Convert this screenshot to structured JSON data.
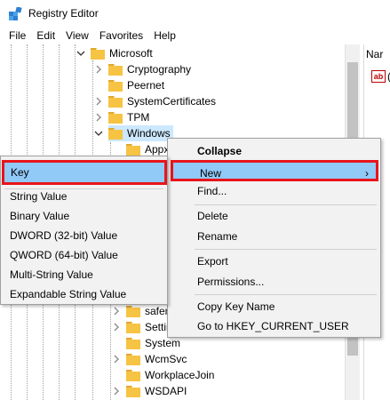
{
  "window": {
    "title": "Registry Editor",
    "icon": "registry-editor-icon"
  },
  "menubar": {
    "items": [
      {
        "label": "File"
      },
      {
        "label": "Edit"
      },
      {
        "label": "View"
      },
      {
        "label": "Favorites"
      },
      {
        "label": "Help"
      }
    ]
  },
  "tree": {
    "microsoft": "Microsoft",
    "children": [
      {
        "label": "Cryptography"
      },
      {
        "label": "Peernet"
      },
      {
        "label": "SystemCertificates"
      },
      {
        "label": "TPM"
      },
      {
        "label": "Windows"
      }
    ],
    "windows_children": [
      {
        "label": "Appx"
      }
    ],
    "lower_items": [
      {
        "label": "safer"
      },
      {
        "label": "Settin"
      },
      {
        "label": "System"
      },
      {
        "label": "WcmSvc"
      },
      {
        "label": "WorkplaceJoin"
      },
      {
        "label": "WSDAPI"
      }
    ]
  },
  "right_pane": {
    "header": "Nar",
    "row_text": "("
  },
  "context_menu": {
    "collapse": "Collapse",
    "new": "New",
    "new_arrow": "›",
    "find": "Find...",
    "delete": "Delete",
    "rename": "Rename",
    "export": "Export",
    "permissions": "Permissions...",
    "copy_key_name": "Copy Key Name",
    "goto": "Go to HKEY_CURRENT_USER"
  },
  "new_submenu": {
    "key": "Key",
    "items": [
      {
        "label": "String Value"
      },
      {
        "label": "Binary Value"
      },
      {
        "label": "DWORD (32-bit) Value"
      },
      {
        "label": "QWORD (64-bit) Value"
      },
      {
        "label": "Multi-String Value"
      },
      {
        "label": "Expandable String Value"
      }
    ]
  },
  "colors": {
    "highlight": "#91c9f7",
    "annotation_red": "#e8141b",
    "folder": "#f6c343",
    "selected_row": "#cce8ff"
  }
}
